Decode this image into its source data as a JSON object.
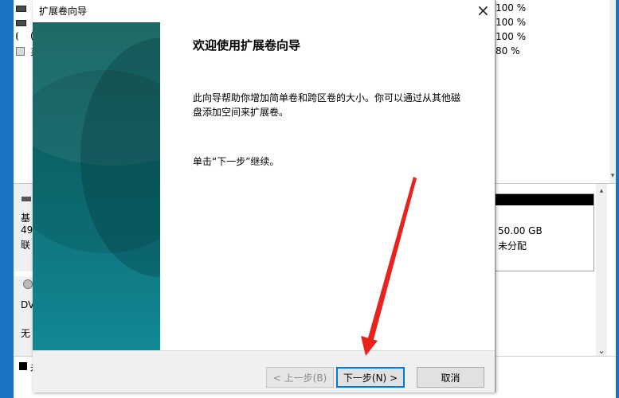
{
  "background_window": {
    "top_list": {
      "rows": [
        {
          "pct": "100 %",
          "left_glyph": ""
        },
        {
          "pct": "100 %",
          "left_glyph": ""
        },
        {
          "pct": "100 %",
          "left_glyph": "("
        },
        {
          "pct": "80 %",
          "left_glyph": "系"
        }
      ]
    },
    "disk0": {
      "label_line1": "基",
      "label_line2": "49",
      "label_line3": "联",
      "unallocated_size": "50.00 GB",
      "unallocated_label": "未分配"
    },
    "dvd": {
      "label_line1": "DV",
      "label_line2": "无"
    },
    "legend": {
      "text": "未"
    }
  },
  "wizard": {
    "title": "扩展卷向导",
    "heading": "欢迎使用扩展卷向导",
    "description": "此向导帮助你增加简单卷和跨区卷的大小。你可以通过从其他磁盘添加空间来扩展卷。",
    "instruction": "单击“下一步”继续。",
    "buttons": {
      "back": "< 上一步(B)",
      "next": "下一步(N) >",
      "cancel": "取消"
    },
    "close_icon": "×"
  },
  "colors": {
    "desktop": "#1b73c6",
    "banner_dark": "#0d5e5a",
    "banner_light": "#118995",
    "annotation_arrow": "#e8231e",
    "default_button_border": "#0078d7"
  }
}
